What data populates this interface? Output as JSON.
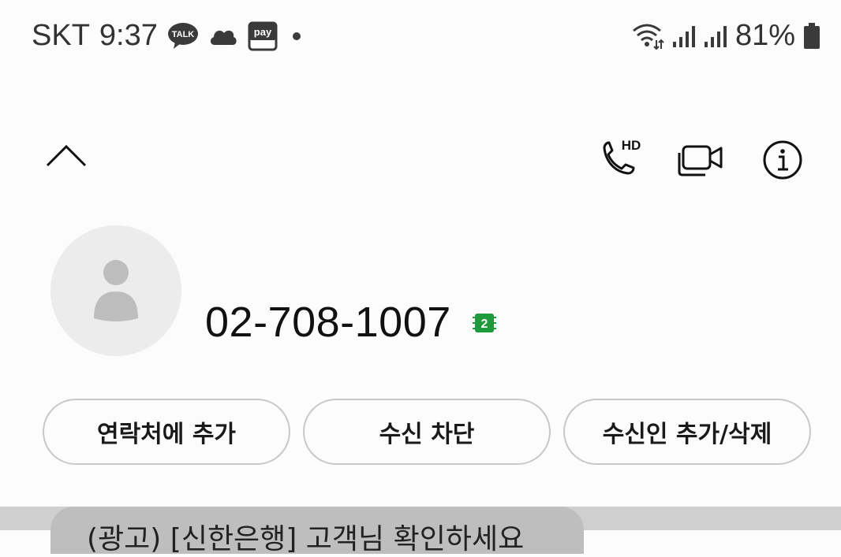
{
  "status_bar": {
    "carrier": "SKT",
    "time": "9:37",
    "talk_icon_text": "TALK",
    "pay_icon_text": "pay",
    "battery": "81%"
  },
  "contact": {
    "phone_number": "02-708-1007",
    "sim_badge": "2"
  },
  "actions": [
    {
      "label": "연락처에 추가"
    },
    {
      "label": "수신 차단"
    },
    {
      "label": "수신인 추가/삭제"
    }
  ],
  "message_preview": {
    "text": "(광고) [신한은행] 고객님 확인하세요"
  },
  "colors": {
    "background": "#fcfcfc",
    "sim_badge": "#1e9a3c",
    "button_border": "#c8c8c8"
  }
}
